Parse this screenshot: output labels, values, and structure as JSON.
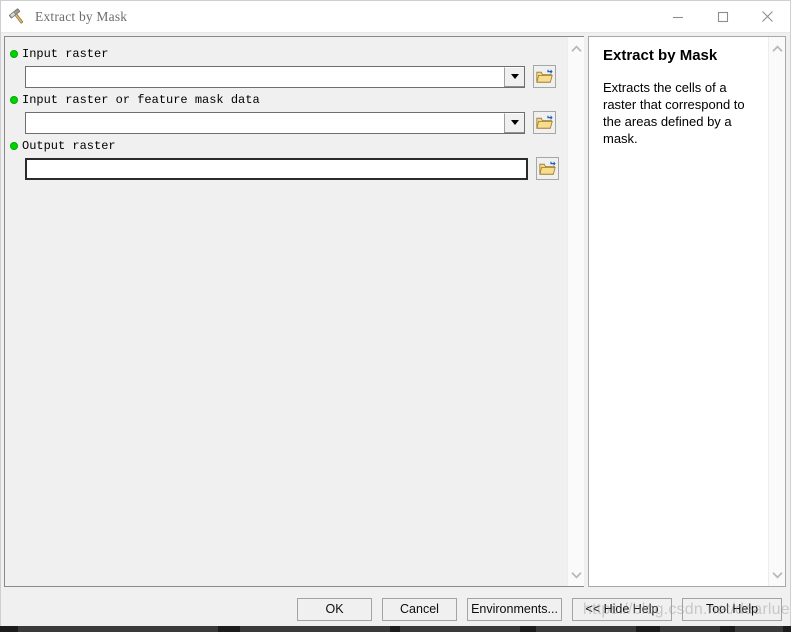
{
  "window": {
    "title": "Extract by Mask",
    "icon": "hammer-tool-icon",
    "minimize_label": "—",
    "maximize_label": "□",
    "close_label": "✕"
  },
  "form": {
    "params": [
      {
        "label": "Input raster",
        "required": true,
        "value": "",
        "placeholder": "",
        "has_dropdown": true,
        "browse_label": "browse-folder-icon"
      },
      {
        "label": "Input raster or feature mask data",
        "required": true,
        "value": "",
        "placeholder": "",
        "has_dropdown": true,
        "browse_label": "browse-folder-icon"
      },
      {
        "label": "Output raster",
        "required": true,
        "value": "",
        "placeholder": "",
        "has_dropdown": false,
        "browse_label": "browse-folder-icon"
      }
    ],
    "scroll_up_icon": "chevron-up-icon",
    "scroll_down_icon": "chevron-down-icon"
  },
  "help": {
    "title": "Extract by Mask",
    "body": "Extracts the cells of a raster that correspond to the areas defined by a mask.",
    "scroll_up_icon": "chevron-up-icon",
    "scroll_down_icon": "chevron-down-icon"
  },
  "footer": {
    "ok_label": "OK",
    "cancel_label": "Cancel",
    "environments_label": "Environments...",
    "hide_help_label": "<< Hide Help",
    "tool_help_label": "Tool Help"
  },
  "watermark": {
    "text": "https://blog.csdn.net/dearluer"
  },
  "colors": {
    "required_dot": "#00d300",
    "dialog_bg": "#f0f0f0",
    "help_bg": "#ffffff",
    "title_text": "#6d6d6d",
    "folder_icon": "#e8c24a",
    "folder_arrow": "#1a5fb4"
  }
}
